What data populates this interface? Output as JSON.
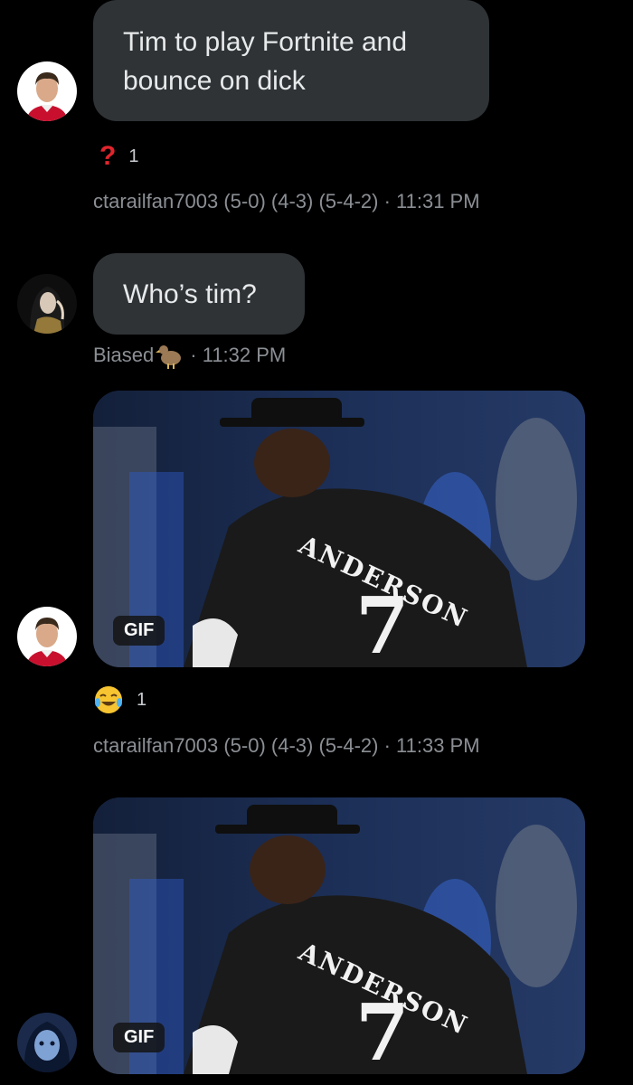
{
  "messages": [
    {
      "text": "Tim to play Fortnite and bounce on dick",
      "reaction": {
        "icon": "question-mark-emoji",
        "count": "1"
      },
      "meta": "ctarailfan7003 (5-0) (4-3) (5-4-2) · 11:31 PM"
    },
    {
      "text": "Who’s tim?",
      "sender": "Biased",
      "time": "· 11:32 PM"
    },
    {
      "gif_label": "GIF",
      "reaction": {
        "icon": "laughing-tears-emoji",
        "count": "1"
      },
      "meta": "ctarailfan7003 (5-0) (4-3) (5-4-2) · 11:33 PM"
    },
    {
      "gif_label": "GIF"
    }
  ],
  "gif": {
    "jersey_name": "ANDERSON",
    "jersey_number": "7"
  }
}
